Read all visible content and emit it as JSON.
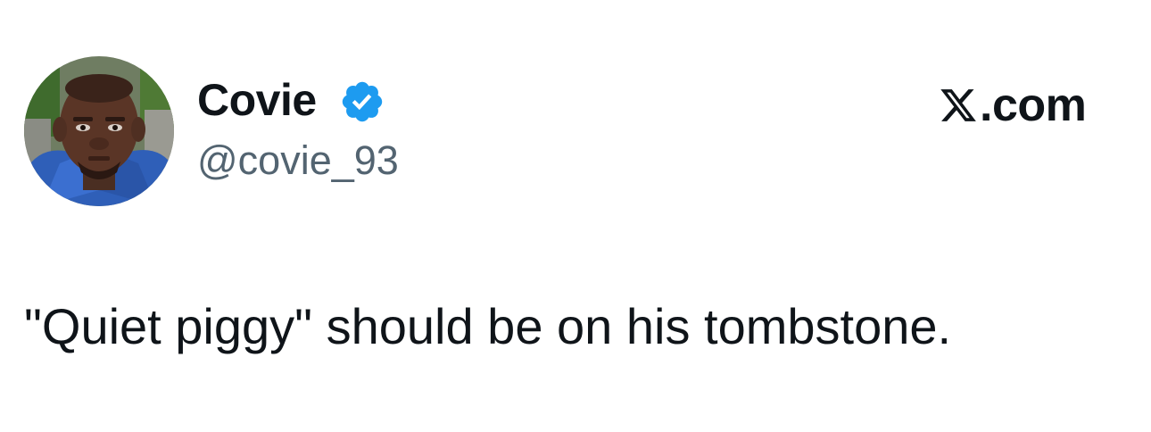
{
  "tweet": {
    "author": {
      "display_name": "Covie",
      "handle": "@covie_93",
      "verified": true,
      "verified_badge_icon": "verified-checkmark-icon",
      "avatar_icon": "user-avatar-photo"
    },
    "text": "\"Quiet piggy\" should be on his tombstone.",
    "source": {
      "brand_icon": "x-logo-icon",
      "domain_suffix": ".com"
    }
  },
  "colors": {
    "text_primary": "#0f1419",
    "text_secondary": "#536471",
    "verified_blue": "#1d9bf0",
    "background": "#ffffff"
  }
}
